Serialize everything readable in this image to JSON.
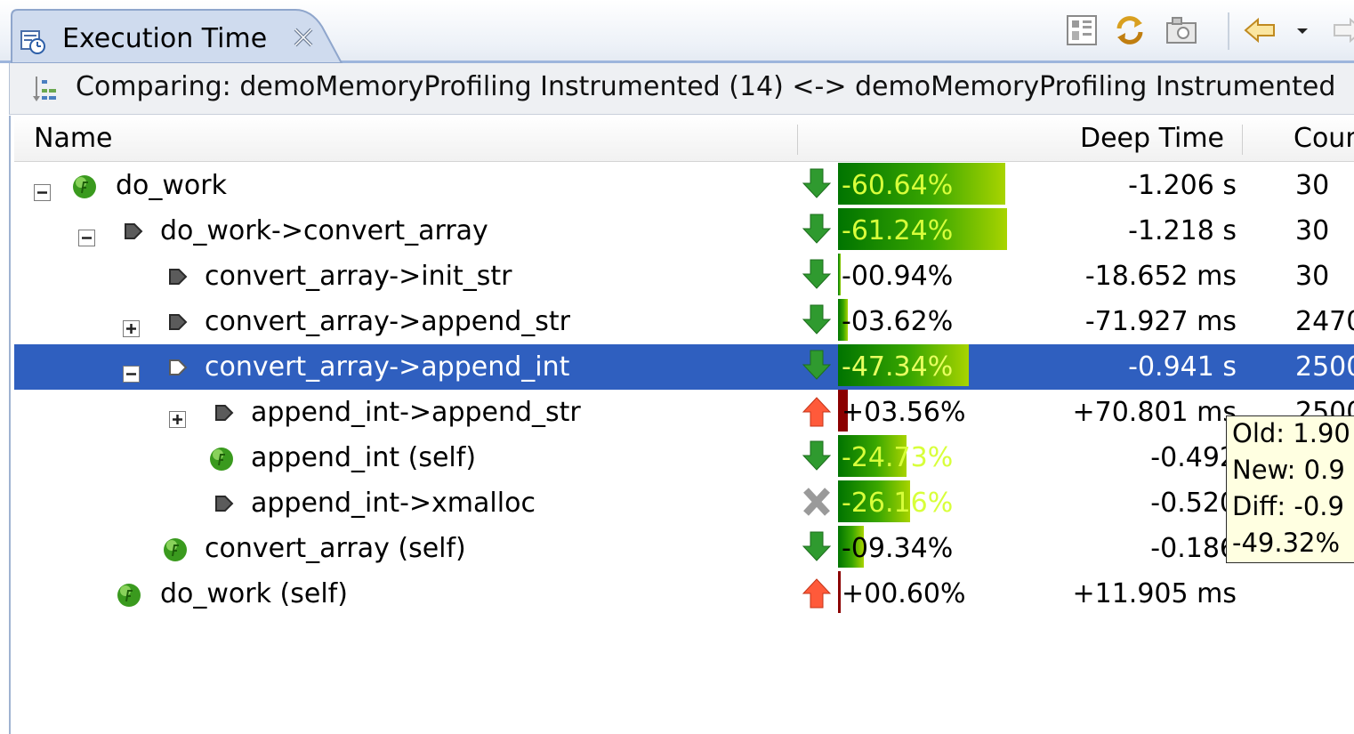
{
  "tab": {
    "title": "Execution Time"
  },
  "banner": {
    "text": "Comparing: demoMemoryProfiling Instrumented (14) <-> demoMemoryProfiling Instrumented"
  },
  "columns": {
    "name": "Name",
    "deep_time": "Deep Time",
    "count": "Coun"
  },
  "rows": [
    {
      "name": "do_work",
      "percent": "-60.64%",
      "bar_fraction": 0.6064,
      "deep_time": "-1.206  s",
      "count": "30",
      "trend": "down",
      "selected": false
    },
    {
      "name": "do_work->convert_array",
      "percent": "-61.24%",
      "bar_fraction": 0.6124,
      "deep_time": "-1.218  s",
      "count": "30",
      "trend": "down",
      "selected": false
    },
    {
      "name": "convert_array->init_str",
      "percent": "-00.94%",
      "bar_fraction": 0.0094,
      "deep_time": "-18.652 ms",
      "count": "30",
      "trend": "down",
      "selected": false
    },
    {
      "name": "convert_array->append_str",
      "percent": "-03.62%",
      "bar_fraction": 0.0362,
      "deep_time": "-71.927 ms",
      "count": "2470",
      "trend": "down",
      "selected": false
    },
    {
      "name": "convert_array->append_int",
      "percent": "-47.34%",
      "bar_fraction": 0.4734,
      "deep_time": "-0.941  s",
      "count": "2500",
      "trend": "down",
      "selected": true
    },
    {
      "name": "append_int->append_str",
      "percent": "+03.56%",
      "bar_fraction": 0.0356,
      "deep_time": "+70.801 ms",
      "count": "2500",
      "trend": "up",
      "selected": false
    },
    {
      "name": "append_int (self)",
      "percent": "-24.73%",
      "bar_fraction": 0.2473,
      "deep_time": "-0.492",
      "count": "",
      "trend": "down",
      "selected": false
    },
    {
      "name": "append_int->xmalloc",
      "percent": "-26.16%",
      "bar_fraction": 0.2616,
      "deep_time": "-0.520",
      "count": "",
      "trend": "removed",
      "selected": false
    },
    {
      "name": "convert_array (self)",
      "percent": "-09.34%",
      "bar_fraction": 0.0934,
      "deep_time": "-0.186",
      "count": "",
      "trend": "down",
      "selected": false
    },
    {
      "name": "do_work (self)",
      "percent": "+00.60%",
      "bar_fraction": 0.006,
      "deep_time": "+11.905 ms",
      "count": "",
      "trend": "up",
      "selected": false
    }
  ],
  "tooltip": {
    "old": "Old: 1.90",
    "new": "New: 0.9",
    "diff": "Diff: -0.9",
    "percent": "-49.32%"
  },
  "colors": {
    "selection": "#2f5fbf",
    "bar_green": "#39a600",
    "bar_red": "#8b0000",
    "tooltip_bg": "#ffffe1",
    "tab_border": "#9db5dc"
  },
  "icons": {
    "tab": "stopwatch-icon",
    "close": "close-icon",
    "banner": "compare-icon",
    "toolbar": [
      "layout-icon",
      "refresh-icon",
      "camera-icon",
      "back-arrow-icon",
      "dropdown-icon",
      "forward-arrow-icon"
    ]
  }
}
